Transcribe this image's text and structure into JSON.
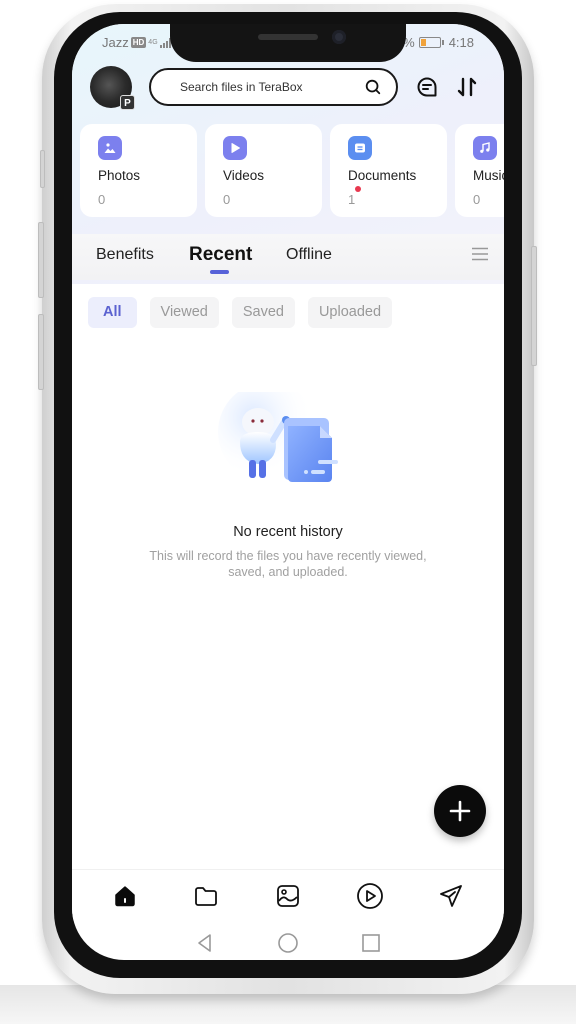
{
  "status_bar": {
    "carrier": "Jazz",
    "hd_label": "HD",
    "network": "4G",
    "battery_suffix": "%",
    "time": "4:18"
  },
  "header": {
    "avatar_badge": "P",
    "search_placeholder": "Search files in TeraBox",
    "icons": [
      "search-icon",
      "message-icon",
      "transfer-icon"
    ]
  },
  "categories": [
    {
      "label": "Photos",
      "count": "0",
      "icon": "photo-icon",
      "color": "#7c80ee",
      "has_dot": false
    },
    {
      "label": "Videos",
      "count": "0",
      "icon": "play-icon",
      "color": "#7c80ee",
      "has_dot": false
    },
    {
      "label": "Documents",
      "count": "1",
      "icon": "document-icon",
      "color": "#5b8ef0",
      "has_dot": true
    },
    {
      "label": "Music",
      "count": "0",
      "icon": "music-icon",
      "color": "#7c80ee",
      "has_dot": false
    }
  ],
  "tabs": [
    {
      "label": "Benefits",
      "active": false
    },
    {
      "label": "Recent",
      "active": true
    },
    {
      "label": "Offline",
      "active": false
    }
  ],
  "filters": [
    {
      "label": "All",
      "active": true
    },
    {
      "label": "Viewed",
      "active": false
    },
    {
      "label": "Saved",
      "active": false
    },
    {
      "label": "Uploaded",
      "active": false
    }
  ],
  "empty_state": {
    "title": "No recent history",
    "description_line1": "This will record the files you have recently viewed,",
    "description_line2": "saved, and uploaded."
  },
  "fab": {
    "icon": "plus-icon"
  },
  "bottom_nav": [
    {
      "name": "home",
      "icon": "home-icon",
      "active": true
    },
    {
      "name": "files",
      "icon": "folder-icon",
      "active": false
    },
    {
      "name": "photos",
      "icon": "image-icon",
      "active": false
    },
    {
      "name": "videos",
      "icon": "play-circle-icon",
      "active": false
    },
    {
      "name": "share",
      "icon": "send-icon",
      "active": false
    }
  ],
  "system_nav": [
    "back-icon",
    "home-circle-icon",
    "recents-icon"
  ],
  "colors": {
    "accent": "#5762d8",
    "fab": "#0b0b0b",
    "notification_dot": "#e8384f"
  }
}
